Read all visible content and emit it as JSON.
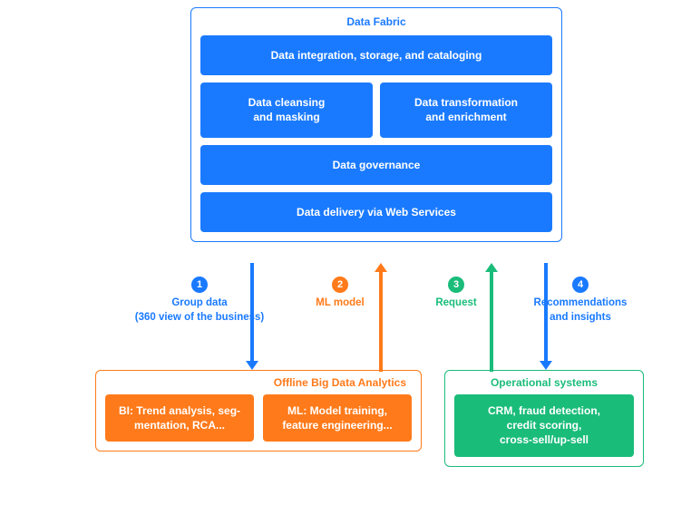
{
  "dataFabric": {
    "title": "Data Fabric",
    "box_integration": "Data integration, storage, and cataloging",
    "box_cleansing": "Data cleansing\nand masking",
    "box_transform": "Data transformation\nand enrichment",
    "box_governance": "Data governance",
    "box_delivery": "Data delivery via Web Services"
  },
  "flows": {
    "f1": {
      "num": "1",
      "label": "Group data\n(360 view of the business)"
    },
    "f2": {
      "num": "2",
      "label": "ML model"
    },
    "f3": {
      "num": "3",
      "label": "Request"
    },
    "f4": {
      "num": "4",
      "label": "Recommendations\nand insights"
    }
  },
  "offline": {
    "title": "Offline Big Data Analytics",
    "box_bi": "BI: Trend analysis, seg-\nmentation, RCA...",
    "box_ml": "ML: Model training,\nfeature engineering..."
  },
  "opsys": {
    "title": "Operational systems",
    "box": "CRM, fraud detection,\ncredit scoring,\ncross-sell/up-sell"
  }
}
